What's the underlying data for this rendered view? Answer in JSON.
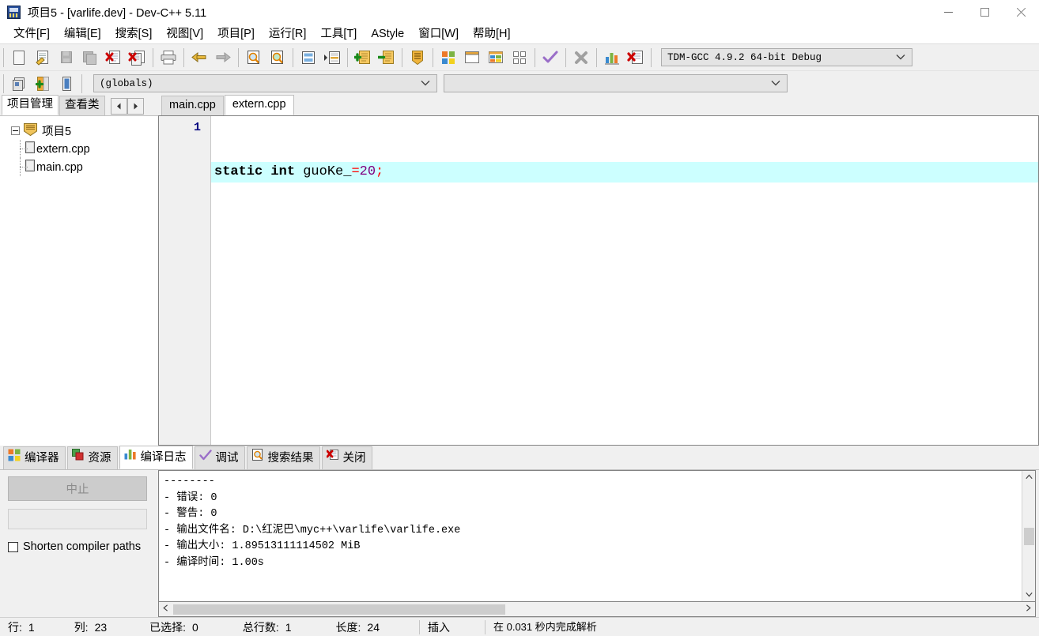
{
  "window": {
    "title": "项目5 - [varlife.dev] - Dev-C++ 5.11",
    "icon": "devcpp-app-icon",
    "controls": {
      "minimize": "–",
      "maximize": "☐",
      "close": "✕"
    }
  },
  "menu": {
    "items": [
      {
        "label": "文件[F]",
        "name": "menu-file"
      },
      {
        "label": "编辑[E]",
        "name": "menu-edit"
      },
      {
        "label": "搜索[S]",
        "name": "menu-search"
      },
      {
        "label": "视图[V]",
        "name": "menu-view"
      },
      {
        "label": "项目[P]",
        "name": "menu-project"
      },
      {
        "label": "运行[R]",
        "name": "menu-run"
      },
      {
        "label": "工具[T]",
        "name": "menu-tools"
      },
      {
        "label": "AStyle",
        "name": "menu-astyle"
      },
      {
        "label": "窗口[W]",
        "name": "menu-window"
      },
      {
        "label": "帮助[H]",
        "name": "menu-help"
      }
    ]
  },
  "toolbar": {
    "row1": [
      {
        "icon": "new-file-icon"
      },
      {
        "icon": "open-file-icon"
      },
      {
        "icon": "save-file-icon"
      },
      {
        "icon": "save-all-icon"
      },
      {
        "icon": "close-file-icon"
      },
      {
        "icon": "close-all-icon"
      },
      {
        "sep": true
      },
      {
        "icon": "print-icon"
      },
      {
        "sep": true
      },
      {
        "icon": "undo-icon"
      },
      {
        "icon": "redo-icon"
      },
      {
        "sep": true
      },
      {
        "icon": "find-icon"
      },
      {
        "icon": "replace-icon"
      },
      {
        "sep": true
      },
      {
        "icon": "goto-line-icon"
      },
      {
        "icon": "indent-icon"
      },
      {
        "sep": true
      },
      {
        "icon": "add-to-project-icon"
      },
      {
        "icon": "remove-from-project-icon"
      },
      {
        "sep": true
      },
      {
        "icon": "project-options-icon"
      },
      {
        "sep": true
      },
      {
        "icon": "compile-icon"
      },
      {
        "icon": "run-icon"
      },
      {
        "icon": "compile-run-icon"
      },
      {
        "icon": "rebuild-all-icon"
      },
      {
        "sep": true
      },
      {
        "icon": "syntax-check-icon"
      },
      {
        "sep": true
      },
      {
        "icon": "stop-execution-icon"
      },
      {
        "sep": true
      },
      {
        "icon": "profile-icon"
      },
      {
        "icon": "delete-profile-icon"
      }
    ],
    "compiler_set": {
      "value": "TDM-GCC 4.9.2 64-bit Debug",
      "name": "compiler-set-combo"
    },
    "row2": [
      {
        "icon": "insert-icon"
      },
      {
        "icon": "toggle-icon"
      },
      {
        "icon": "goto-function-icon"
      }
    ],
    "scope_combo": {
      "value": "(globals)",
      "name": "scope-combo"
    },
    "member_combo": {
      "value": "",
      "name": "member-combo"
    }
  },
  "left_panel": {
    "tabs": [
      {
        "label": "项目管理",
        "active": true
      },
      {
        "label": "查看类",
        "active": false
      }
    ],
    "spinner": {
      "prev": "◀",
      "next": "▶"
    },
    "tree": {
      "root": {
        "label": "项目5",
        "icon": "project-icon",
        "expanded": true
      },
      "files": [
        {
          "label": "extern.cpp",
          "icon": "cpp-file-icon"
        },
        {
          "label": "main.cpp",
          "icon": "cpp-file-icon"
        }
      ]
    }
  },
  "editor": {
    "tabs": [
      {
        "label": "main.cpp",
        "active": false
      },
      {
        "label": "extern.cpp",
        "active": true
      }
    ],
    "line_numbers": [
      "1"
    ],
    "code_tokens": [
      {
        "text": "static int ",
        "type": "kw"
      },
      {
        "text": "guoKe_",
        "type": "id"
      },
      {
        "text": "=",
        "type": "op"
      },
      {
        "text": "20",
        "type": "num"
      },
      {
        "text": ";",
        "type": "op"
      }
    ],
    "code_plain": "static int guoKe_=20;"
  },
  "bottom_panel": {
    "tabs": [
      {
        "label": "编译器",
        "icon": "compiler-icon",
        "active": false
      },
      {
        "label": "资源",
        "icon": "resources-icon",
        "active": false
      },
      {
        "label": "编译日志",
        "icon": "compile-log-icon",
        "active": true
      },
      {
        "label": "调试",
        "icon": "debug-icon",
        "active": false
      },
      {
        "label": "搜索结果",
        "icon": "search-results-icon",
        "active": false
      },
      {
        "label": "关闭",
        "icon": "close-panel-icon",
        "active": false
      }
    ],
    "abort_button": "中止",
    "progress_value": "",
    "shorten_checkbox": {
      "label": "Shorten compiler paths",
      "checked": false
    },
    "log_lines": [
      "--------",
      "- 错误: 0",
      "- 警告: 0",
      "- 输出文件名: D:\\红泥巴\\myc++\\varlife\\varlife.exe",
      "- 输出大小: 1.89513111114502 MiB",
      "- 编译时间: 1.00s"
    ],
    "scroll": {
      "up": "︿",
      "down": "﹀",
      "left": "‹",
      "right": "›"
    }
  },
  "status_bar": {
    "cells": [
      {
        "key": "行:",
        "value": "1"
      },
      {
        "key": "列:",
        "value": "23"
      },
      {
        "key": "已选择:",
        "value": "0"
      },
      {
        "key": "总行数:",
        "value": "1"
      },
      {
        "key": "长度:",
        "value": "24"
      },
      {
        "key": "插入",
        "value": ""
      }
    ],
    "parse_message": "在 0.031 秒内完成解析"
  },
  "colors": {
    "active_line": "#ccffff",
    "number_token": "#800080",
    "operator_token": "#ff0000",
    "line_number": "#000080",
    "window_bg": "#f0f0f0"
  }
}
